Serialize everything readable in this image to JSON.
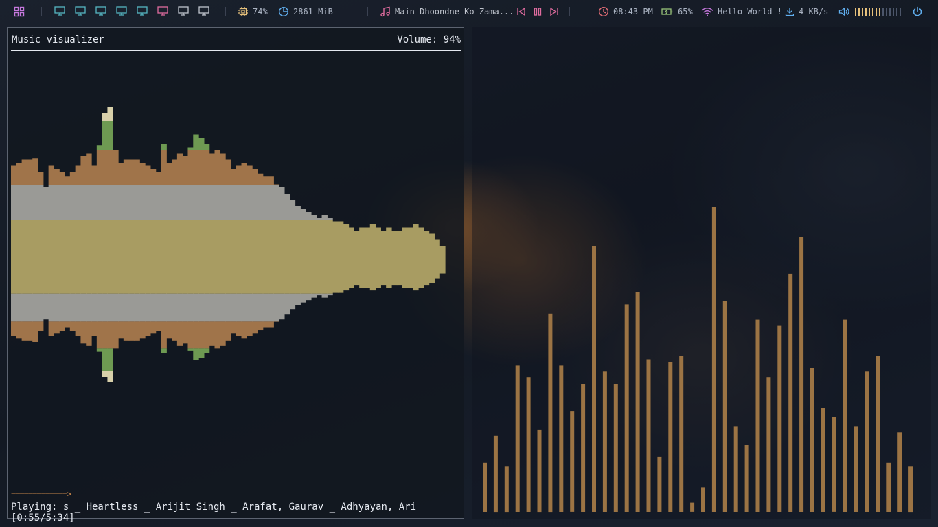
{
  "topbar": {
    "workspace_count": 10,
    "cpu": "74%",
    "memory": "2861 MiB",
    "song": "Main Dhoondne Ko Zama...",
    "time": "08:43 PM",
    "battery": "65%",
    "wifi": "Hello World !",
    "net_speed": "4 KB/s",
    "volume_level_bars": 14,
    "volume_level_filled": 8,
    "colors": {
      "workspace": "#56b6c2",
      "workspace_active": "#e06c9f",
      "workspace_inactive": "#c0c5ce",
      "cpu": "#e5c07b",
      "memory": "#61afef",
      "music": "#e06c9f",
      "clock": "#e06c75",
      "battery": "#98c379",
      "wifi": "#c678dd",
      "net": "#61afef",
      "volume": "#61afef",
      "volume_bar": "#e5c07b",
      "power": "#61afef"
    }
  },
  "terminal": {
    "title": "Music visualizer",
    "volume": "Volume: 94%",
    "progress": "=============>",
    "playing": "Playing: s _ Heartless _ Arijit Singh _ Arafat, Gaurav _ Adhyayan, Ari [0:55/5:34]",
    "viz_colors": {
      "core": "#a89c62",
      "mid": "#9a9a96",
      "outer": "#a0744a",
      "peak": "#6e9a52",
      "cap": "#d8d0aa"
    },
    "spectrum": [
      0.62,
      0.64,
      0.66,
      0.66,
      0.67,
      0.58,
      0.48,
      0.62,
      0.6,
      0.58,
      0.55,
      0.58,
      0.62,
      0.68,
      0.7,
      0.62,
      0.75,
      0.96,
      1.0,
      0.72,
      0.64,
      0.66,
      0.66,
      0.66,
      0.64,
      0.62,
      0.6,
      0.58,
      0.76,
      0.64,
      0.66,
      0.7,
      0.68,
      0.74,
      0.82,
      0.8,
      0.76,
      0.7,
      0.72,
      0.7,
      0.66,
      0.6,
      0.62,
      0.64,
      0.62,
      0.6,
      0.57,
      0.55,
      0.55,
      0.5,
      0.48,
      0.44,
      0.4,
      0.36,
      0.34,
      0.32,
      0.3,
      0.28,
      0.3,
      0.28,
      0.26,
      0.26,
      0.24,
      0.22,
      0.2,
      0.22,
      0.22,
      0.24,
      0.22,
      0.2,
      0.22,
      0.2,
      0.2,
      0.22,
      0.22,
      0.24,
      0.22,
      0.2,
      0.18,
      0.14,
      0.1
    ]
  },
  "bars": {
    "color": "#9c7444",
    "values": [
      0.16,
      0.25,
      0.15,
      0.48,
      0.44,
      0.27,
      0.65,
      0.48,
      0.33,
      0.42,
      0.87,
      0.46,
      0.42,
      0.68,
      0.72,
      0.5,
      0.18,
      0.49,
      0.51,
      0.03,
      0.08,
      1.0,
      0.69,
      0.28,
      0.22,
      0.63,
      0.44,
      0.61,
      0.78,
      0.9,
      0.47,
      0.34,
      0.31,
      0.63,
      0.28,
      0.46,
      0.51,
      0.16,
      0.26,
      0.15
    ]
  }
}
